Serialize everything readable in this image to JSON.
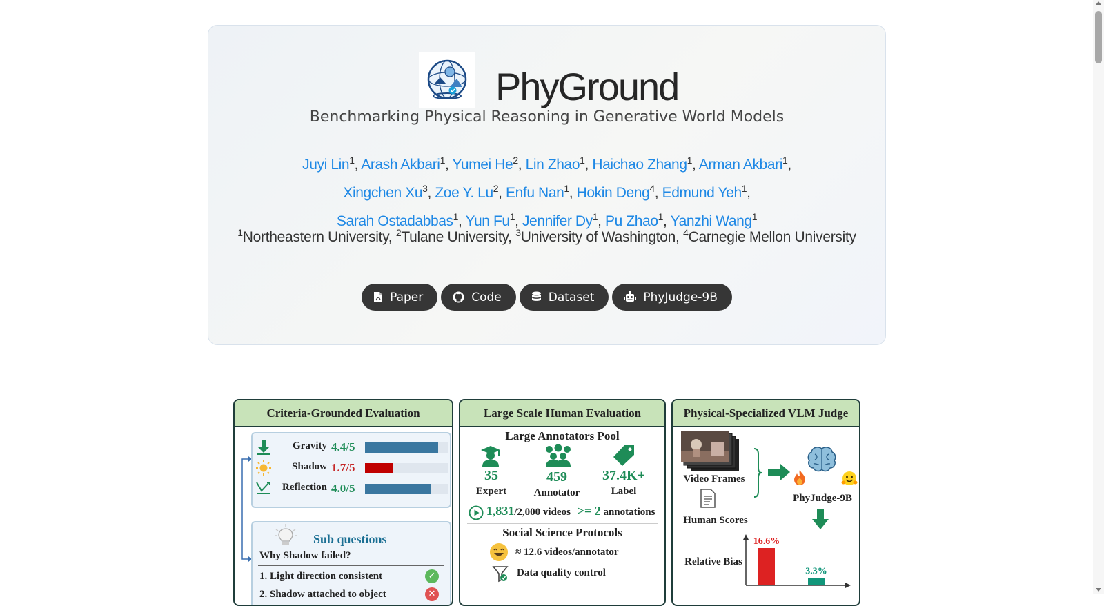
{
  "header": {
    "title": "PhyGround",
    "subtitle": "Benchmarking Physical Reasoning in Generative World Models"
  },
  "authors": [
    {
      "name": "Juyi Lin",
      "aff": "1"
    },
    {
      "name": "Arash Akbari",
      "aff": "1"
    },
    {
      "name": "Yumei He",
      "aff": "2"
    },
    {
      "name": "Lin Zhao",
      "aff": "1"
    },
    {
      "name": "Haichao Zhang",
      "aff": "1"
    },
    {
      "name": "Arman Akbari",
      "aff": "1"
    },
    {
      "name": "Xingchen Xu",
      "aff": "3"
    },
    {
      "name": "Zoe Y. Lu",
      "aff": "2"
    },
    {
      "name": "Enfu Nan",
      "aff": "1"
    },
    {
      "name": "Hokin Deng",
      "aff": "4"
    },
    {
      "name": "Edmund Yeh",
      "aff": "1"
    },
    {
      "name": "Sarah Ostadabbas",
      "aff": "1"
    },
    {
      "name": "Yun Fu",
      "aff": "1"
    },
    {
      "name": "Jennifer Dy",
      "aff": "1"
    },
    {
      "name": "Pu Zhao",
      "aff": "1"
    },
    {
      "name": "Yanzhi Wang",
      "aff": "1"
    }
  ],
  "affiliations": [
    {
      "num": "1",
      "name": "Northeastern University"
    },
    {
      "num": "2",
      "name": "Tulane University"
    },
    {
      "num": "3",
      "name": "University of Washington"
    },
    {
      "num": "4",
      "name": "Carnegie Mellon University"
    }
  ],
  "buttons": [
    {
      "label": "Paper",
      "icon": "file-pdf-icon"
    },
    {
      "label": "Code",
      "icon": "github-icon"
    },
    {
      "label": "Dataset",
      "icon": "database-icon"
    },
    {
      "label": "PhyJudge-9B",
      "icon": "robot-icon"
    }
  ],
  "figure": {
    "panel1": {
      "title": "Criteria-Grounded Evaluation",
      "metrics": [
        {
          "name": "Gravity",
          "score": "4.4/5",
          "value": 4.4,
          "color": "#1e8c57",
          "bar": "#3a77a0"
        },
        {
          "name": "Shadow",
          "score": "1.7/5",
          "value": 1.7,
          "color": "#c62828",
          "bar": "#c00000"
        },
        {
          "name": "Reflection",
          "score": "4.0/5",
          "value": 4.0,
          "color": "#1e8c57",
          "bar": "#3a77a0"
        }
      ],
      "sub_title": "Sub questions",
      "why": "Why Shadow failed?",
      "sub_questions": [
        "1. Light direction consistent",
        "2. Shadow attached to object"
      ]
    },
    "panel2": {
      "title": "Large Scale Human Evaluation",
      "pool_title": "Large Annotators Pool",
      "stats": [
        {
          "value": "35",
          "label": "Expert"
        },
        {
          "value": "459",
          "label": "Annotator"
        },
        {
          "value": "37.4K+",
          "label": "Label"
        }
      ],
      "videos_done": "1,831",
      "videos_total": "/2,000 videos",
      "annot_op": ">= 2",
      "annot_label": "annotations",
      "protocols_title": "Social Science Protocols",
      "per_annotator": "≈ 12.6 videos/annotator",
      "quality": "Data quality control"
    },
    "panel3": {
      "title": "Physical-Specialized VLM Judge",
      "frames_label": "Video Frames",
      "scores_label": "Human Scores",
      "judge_label": "PhyJudge-9B",
      "bias_label": "Relative Bias",
      "bias_values": [
        {
          "label": "16.6%",
          "value": 16.6,
          "color": "#dd2222"
        },
        {
          "label": "3.3%",
          "value": 3.3,
          "color": "#11967a"
        }
      ]
    }
  }
}
